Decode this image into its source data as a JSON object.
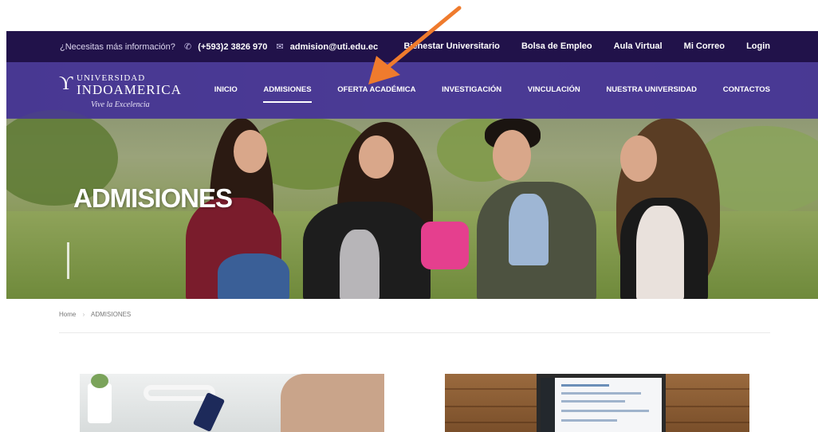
{
  "top_bar": {
    "question": "¿Necesitas más información?",
    "phone_icon": "phone-icon",
    "phone": "(+593)2 3826 970",
    "mail_icon": "mail-icon",
    "email": "admision@uti.edu.ec",
    "links": [
      "Bienestar Universitario",
      "Bolsa de Empleo",
      "Aula Virtual",
      "Mi Correo",
      "Login"
    ]
  },
  "logo": {
    "line1": "UNIVERSIDAD",
    "line2": "INDOAMERICA",
    "tagline": "Vive la Excelencia"
  },
  "nav": {
    "items": [
      "INICIO",
      "ADMISIONES",
      "OFERTA ACADÉMICA",
      "INVESTIGACIÓN",
      "VINCULACIÓN",
      "NUESTRA UNIVERSIDAD",
      "CONTACTOS"
    ],
    "active": "ADMISIONES"
  },
  "hero": {
    "title": "ADMISIONES"
  },
  "breadcrumb": {
    "home": "Home",
    "current": "ADMISIONES"
  },
  "colors": {
    "top_bar": "#21124a",
    "nav": "#483894",
    "arrow": "#ef7b2d"
  }
}
